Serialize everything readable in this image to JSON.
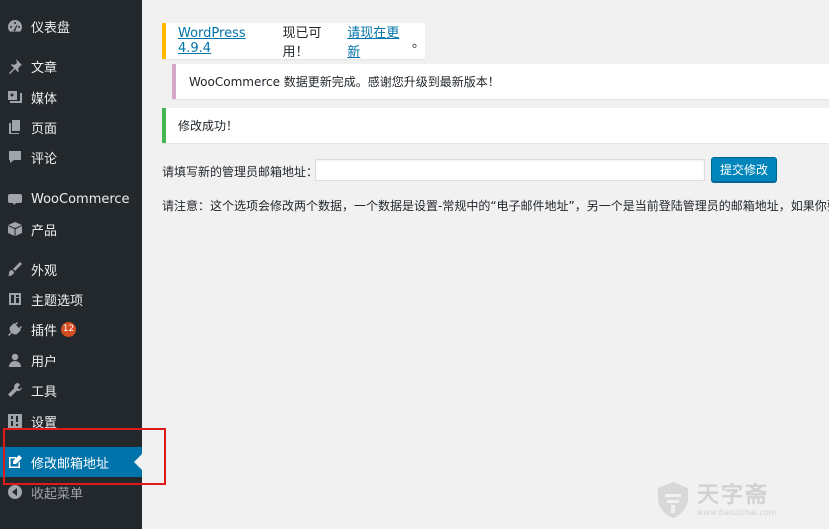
{
  "sidebar": {
    "items": [
      {
        "label": "仪表盘",
        "icon": "dashboard-icon"
      },
      {
        "label": "文章",
        "icon": "pin-icon"
      },
      {
        "label": "媒体",
        "icon": "media-icon"
      },
      {
        "label": "页面",
        "icon": "page-icon"
      },
      {
        "label": "评论",
        "icon": "comment-icon"
      },
      {
        "label": "WooCommerce",
        "icon": "woo-icon"
      },
      {
        "label": "产品",
        "icon": "product-icon"
      },
      {
        "label": "外观",
        "icon": "appearance-icon"
      },
      {
        "label": "主题选项",
        "icon": "theme-options-icon"
      },
      {
        "label": "插件",
        "icon": "plugin-icon",
        "badge": "12"
      },
      {
        "label": "用户",
        "icon": "user-icon"
      },
      {
        "label": "工具",
        "icon": "tools-icon"
      },
      {
        "label": "设置",
        "icon": "settings-icon"
      },
      {
        "label": "修改邮箱地址",
        "icon": "edit-icon",
        "active": true
      },
      {
        "label": "收起菜单",
        "icon": "collapse-icon"
      }
    ]
  },
  "notices": {
    "update": {
      "link": "WordPress 4.9.4",
      "middle": "现已可用！",
      "action": "请现在更新",
      "end": "。"
    },
    "woocommerce": "WooCommerce 数据更新完成。感谢您升级到最新版本！",
    "success": "修改成功！"
  },
  "form": {
    "label": "请填写新的管理员邮箱地址：",
    "value": "",
    "submit": "提交修改"
  },
  "note": "请注意：这个选项会修改两个数据，一个数据是设置-常规中的“电子邮件地址”，另一个是当前登陆管理员的邮箱地址，如果你要修",
  "watermark": {
    "name": "天字斋",
    "url": "www.tianzizhai.com"
  },
  "colors": {
    "sidebar_bg": "#23282d",
    "active_bg": "#0073aa",
    "badge": "#d54e21",
    "highlight": "#e01a1a",
    "button": "#0085ba"
  }
}
